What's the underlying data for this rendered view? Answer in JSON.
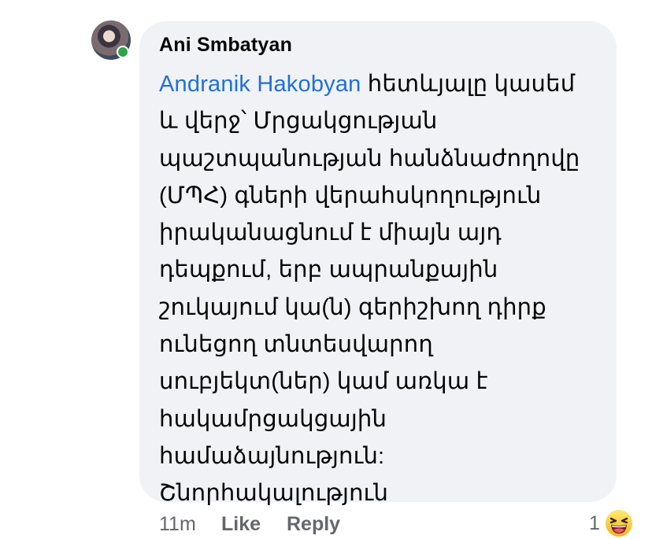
{
  "comment": {
    "author": "Ani Smbatyan",
    "mention": "Andranik Hakobyan",
    "first_line_rest": " հետևյալը կասեմ",
    "lines": [
      "և վերջ՝ Մրցակցության",
      "պաշտպանության հանձնաժողովը",
      "(ՄՊՀ) գների վերահսկողություն",
      "իրականացնում է միայն այդ",
      "դեպքում, երբ ապրանքային",
      "շուկայում կա(ն) գերիշխող դիրք",
      "ունեցող տնտեսվարող",
      "սուբյեկտ(ներ) կամ առկա է",
      "հակամրցակցային",
      "համաձայնություն:",
      "Շնորհակալություն"
    ]
  },
  "actions": {
    "time": "11m",
    "like_label": "Like",
    "reply_label": "Reply"
  },
  "reactions": {
    "count": "1",
    "icon": "laughing-emoji-icon"
  },
  "colors": {
    "bubble": "#f0f2f5",
    "mention": "#216fdb",
    "online": "#31a24c",
    "meta": "#65676b"
  }
}
